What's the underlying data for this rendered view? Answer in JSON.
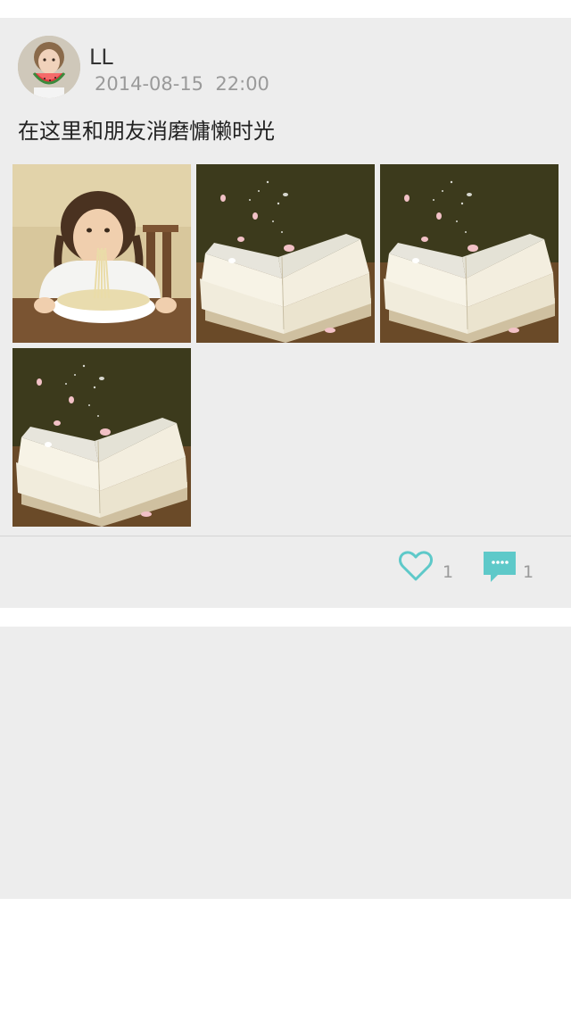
{
  "post": {
    "username": "LL",
    "timestamp": "2014-08-15  22:00",
    "text": "在这里和朋友消磨慵懒时光",
    "photos": [
      {
        "subject": "girl-eating-noodles"
      },
      {
        "subject": "open-book-with-petals"
      },
      {
        "subject": "open-book-with-petals"
      },
      {
        "subject": "open-book-with-petals"
      }
    ],
    "likes": "1",
    "comments": "1"
  },
  "colors": {
    "card_background": "#ededed",
    "page_background": "#ffffff",
    "accent": "#5ec9c9",
    "username": "#333333",
    "timestamp": "#9a9a9a"
  },
  "icons": {
    "like": "heart-outline-icon",
    "comment": "speech-bubble-icon"
  }
}
